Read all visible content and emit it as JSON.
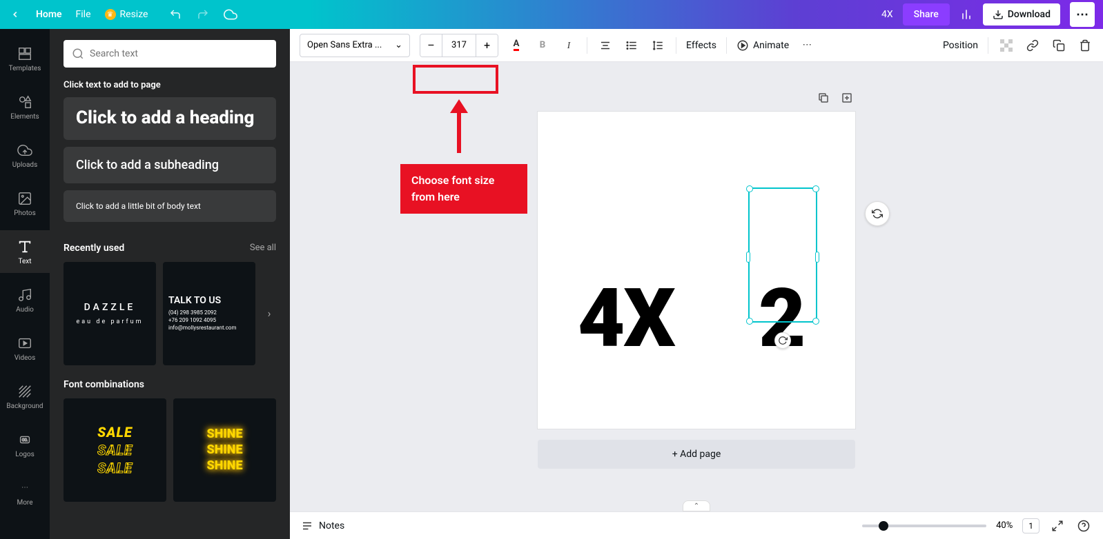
{
  "topbar": {
    "home": "Home",
    "file": "File",
    "resize": "Resize",
    "doc_title": "4X",
    "share": "Share",
    "download": "Download"
  },
  "iconbar": {
    "templates": "Templates",
    "elements": "Elements",
    "uploads": "Uploads",
    "photos": "Photos",
    "text": "Text",
    "audio": "Audio",
    "videos": "Videos",
    "background": "Background",
    "logos": "Logos",
    "more": "More"
  },
  "panel": {
    "search_placeholder": "Search text",
    "label": "Click text to add to page",
    "heading": "Click to add a heading",
    "subheading": "Click to add a subheading",
    "body": "Click to add a little bit of body text",
    "recent": "Recently used",
    "see_all": "See all",
    "fontcomb": "Font combinations",
    "thumbs": {
      "dazzle_title": "DAZZLE",
      "dazzle_sub": "eau de parfum",
      "talk_title": "TALK TO US",
      "talk_l1": "(04) 298 3985 2092",
      "talk_l2": "+76 209 1092 4095",
      "talk_l3": "info@mollysrestaurant.com",
      "sale": "SALE",
      "shine": "SHINE"
    }
  },
  "toolbar": {
    "font": "Open Sans Extra ...",
    "size": "317",
    "effects": "Effects",
    "animate": "Animate",
    "position": "Position"
  },
  "canvas": {
    "text1": "4X",
    "text2": "2",
    "add_page": "+ Add page"
  },
  "callout": {
    "text": "Choose font size from here"
  },
  "bottom": {
    "notes": "Notes",
    "zoom": "40%",
    "pages": "1"
  }
}
